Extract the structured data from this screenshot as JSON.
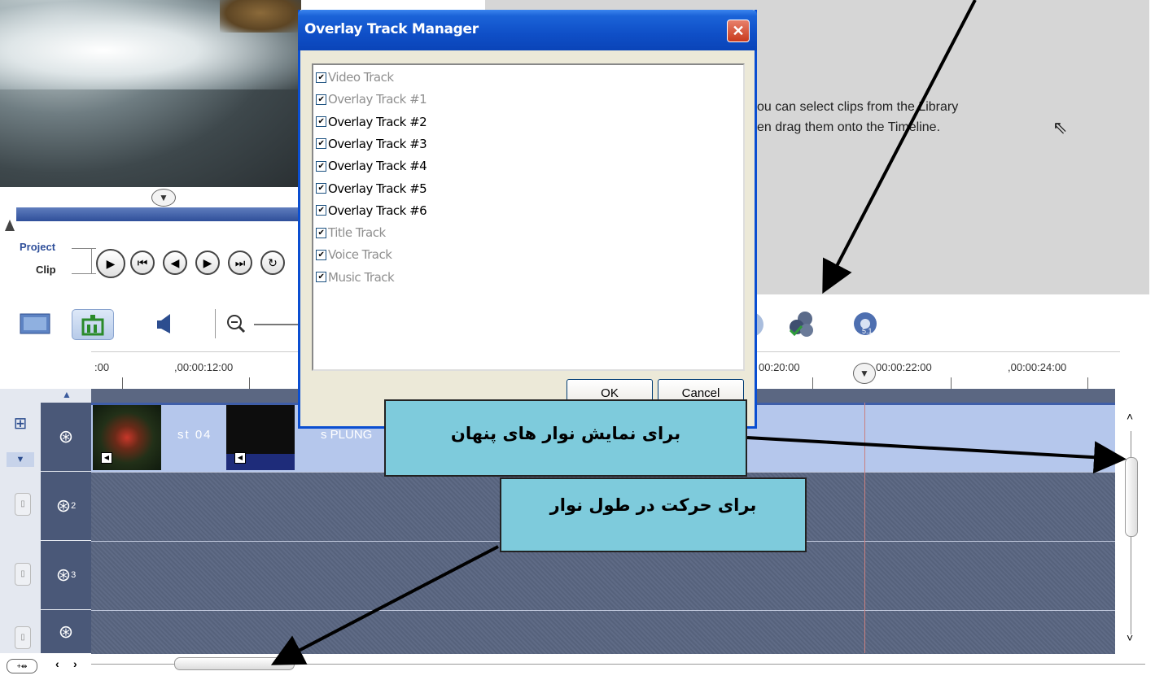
{
  "player": {
    "project_label": "Project",
    "clip_label": "Clip",
    "buttons": [
      "play-icon",
      "home-icon",
      "previous-frame-icon",
      "next-frame-icon",
      "end-icon",
      "repeat-icon"
    ]
  },
  "info_panel": {
    "line1": "ou can select clips from the Library",
    "line2": "en drag them onto the Timeline."
  },
  "toolbar": {
    "buttons": [
      "storyboard-view-icon",
      "timeline-view-icon",
      "audio-view-icon",
      "zoom-out-icon",
      "overlay-track-manager-icon",
      "surround-sound-icon"
    ]
  },
  "ruler": {
    "ticks": [
      ":00",
      ",00:00:12:00",
      "00:20:00",
      "00:00:22:00",
      ",00:00:24:00"
    ]
  },
  "timeline": {
    "clip2_text": "st 04",
    "clip3_text": "s PLUNG",
    "track_numbers": [
      "2",
      "3"
    ]
  },
  "dialog": {
    "title": "Overlay Track Manager",
    "close": "✕",
    "tracks": [
      {
        "label": "Video Track",
        "checked": true,
        "enabled": false
      },
      {
        "label": "Overlay Track #1",
        "checked": true,
        "enabled": false
      },
      {
        "label": "Overlay Track #2",
        "checked": true,
        "enabled": true
      },
      {
        "label": "Overlay Track #3",
        "checked": true,
        "enabled": true
      },
      {
        "label": "Overlay Track #4",
        "checked": true,
        "enabled": true
      },
      {
        "label": "Overlay Track #5",
        "checked": true,
        "enabled": true
      },
      {
        "label": "Overlay Track #6",
        "checked": true,
        "enabled": true
      },
      {
        "label": "Title Track",
        "checked": true,
        "enabled": false
      },
      {
        "label": "Voice Track",
        "checked": true,
        "enabled": false
      },
      {
        "label": "Music Track",
        "checked": true,
        "enabled": false
      }
    ],
    "ok_label": "OK",
    "cancel_label": "Cancel"
  },
  "annotations": {
    "show_hidden_tracks": "برای  نمایش نوار های پنهان",
    "move_along_track": "برای  حرکت در طول نوار"
  },
  "colors": {
    "annotation_bg": "#7ecbdc",
    "dialog_title": "#0f4fc7",
    "track_bg": "#5b6782",
    "video_track": "#b5c7ec"
  }
}
